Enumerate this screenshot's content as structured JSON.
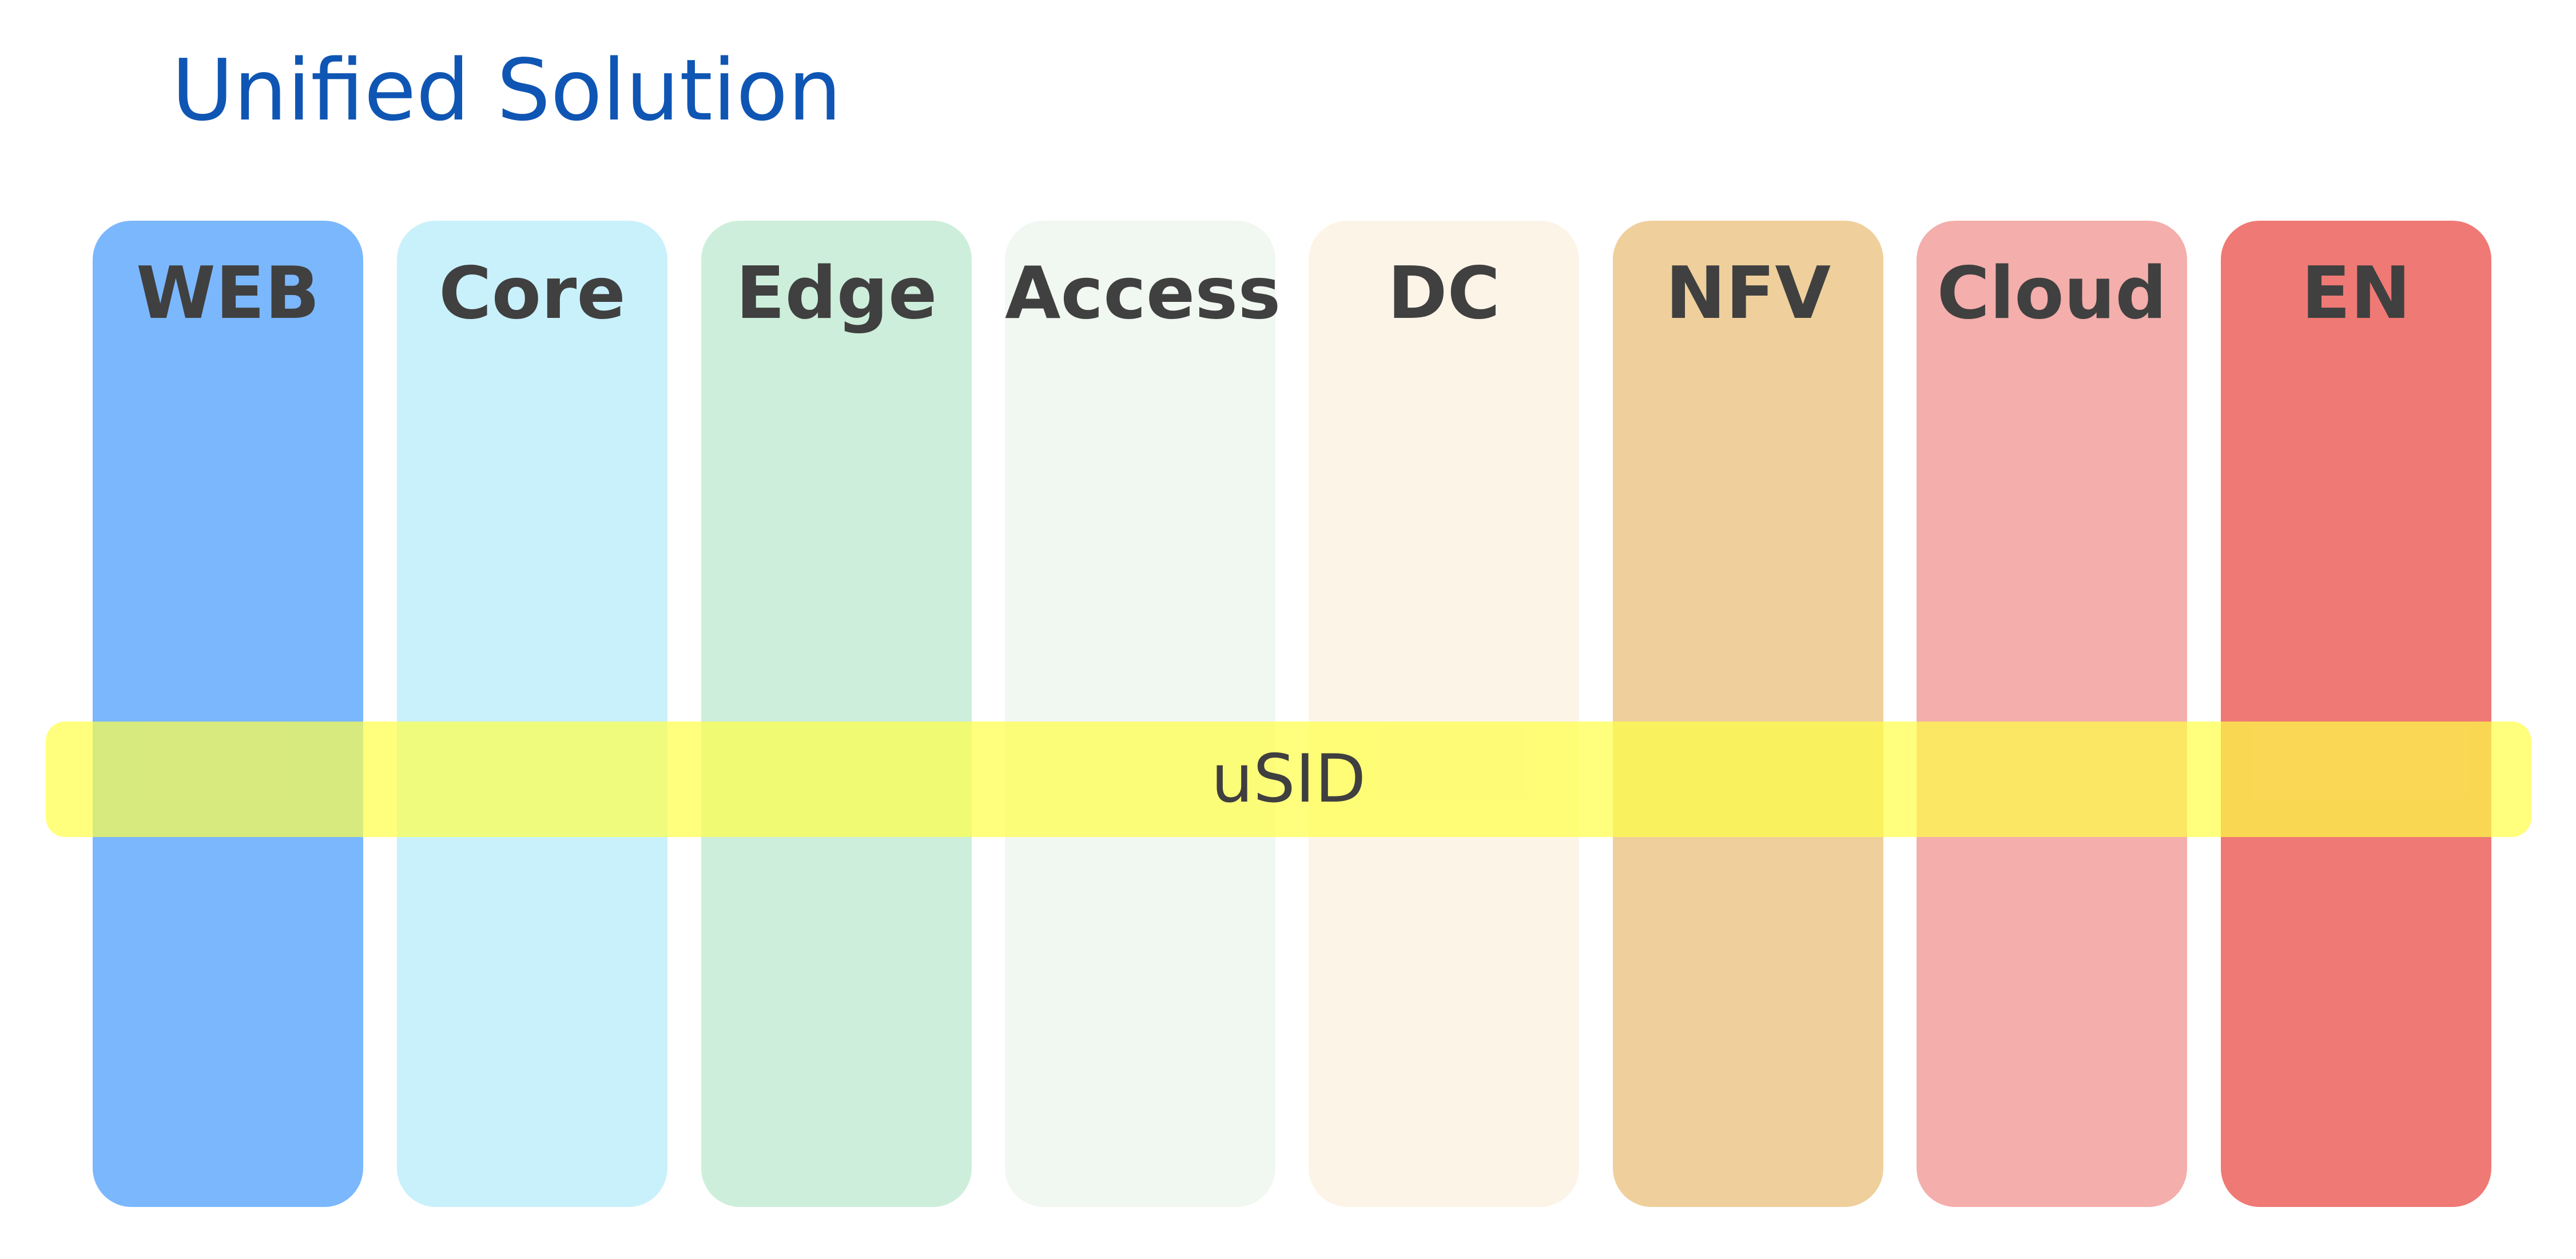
{
  "title": "Unified Solution",
  "columns": [
    {
      "label": "WEB",
      "color": "#7bb7fd"
    },
    {
      "label": "Core",
      "color": "#c9f1fc"
    },
    {
      "label": "Edge",
      "color": "#cdeedb"
    },
    {
      "label": "Access",
      "color": "#f1f7f1"
    },
    {
      "label": "DC",
      "color": "#fdf4e8"
    },
    {
      "label": "NFV",
      "color": "#efcf9b"
    },
    {
      "label": "Cloud",
      "color": "#f4aeab"
    },
    {
      "label": "EN",
      "color": "#ef7974"
    }
  ],
  "band": {
    "label": "uSID",
    "color": "rgba(255, 255, 70, 0.7)"
  },
  "colors": {
    "title": "#0f56b4",
    "column_text": "#404040",
    "band_text": "#3f3f3f"
  }
}
